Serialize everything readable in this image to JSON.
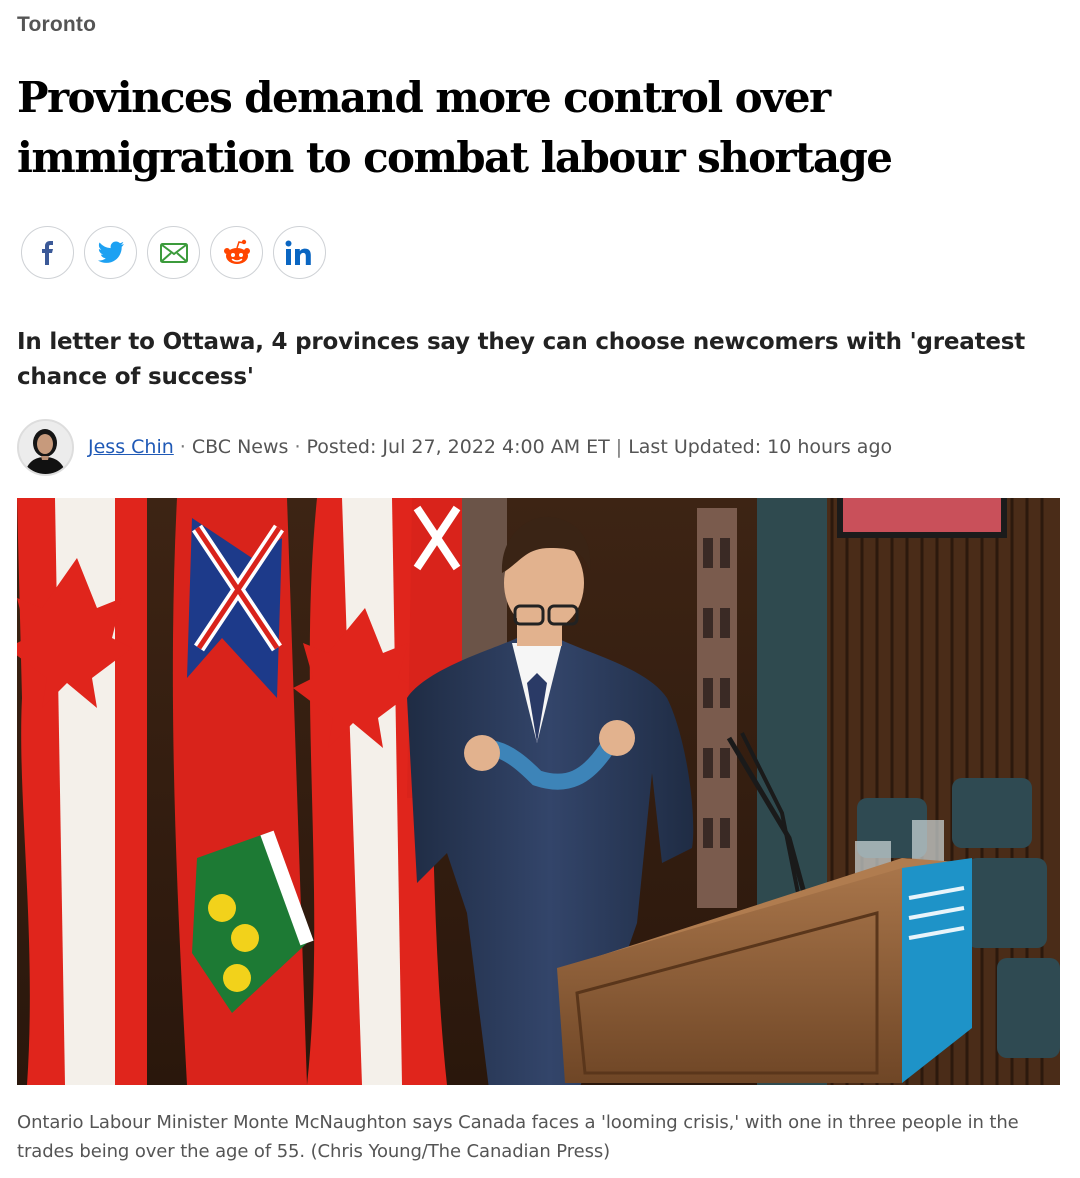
{
  "section": {
    "label": "Toronto"
  },
  "article": {
    "headline": "Provinces demand more control over immigration to combat labour shortage",
    "deck": "In letter to Ottawa, 4 provinces say they can choose newcomers with 'greatest chance of success'",
    "byline": {
      "author": "Jess Chin",
      "outlet": "CBC News",
      "posted": "Posted: Jul 27, 2022 4:00 AM ET",
      "divider": "|",
      "updated": "Last Updated: 10 hours ago"
    },
    "caption": "Ontario Labour Minister Monte McNaughton says Canada faces a 'looming crisis,' with one in three people in the trades being over the age of 55. (Chris Young/The Canadian Press)"
  },
  "share": [
    {
      "id": "facebook",
      "icon": "facebook-icon",
      "color": "#3b5998"
    },
    {
      "id": "twitter",
      "icon": "twitter-icon",
      "color": "#1da1f2"
    },
    {
      "id": "email",
      "icon": "email-icon",
      "color": "#3c9b3c"
    },
    {
      "id": "reddit",
      "icon": "reddit-icon",
      "color": "#ff4500"
    },
    {
      "id": "linkedin",
      "icon": "linkedin-icon",
      "color": "#0a66c2"
    }
  ],
  "colors": {
    "link": "#1f59b6",
    "headline": "#000000",
    "muted": "#555555",
    "flag_red": "#e0251c"
  }
}
